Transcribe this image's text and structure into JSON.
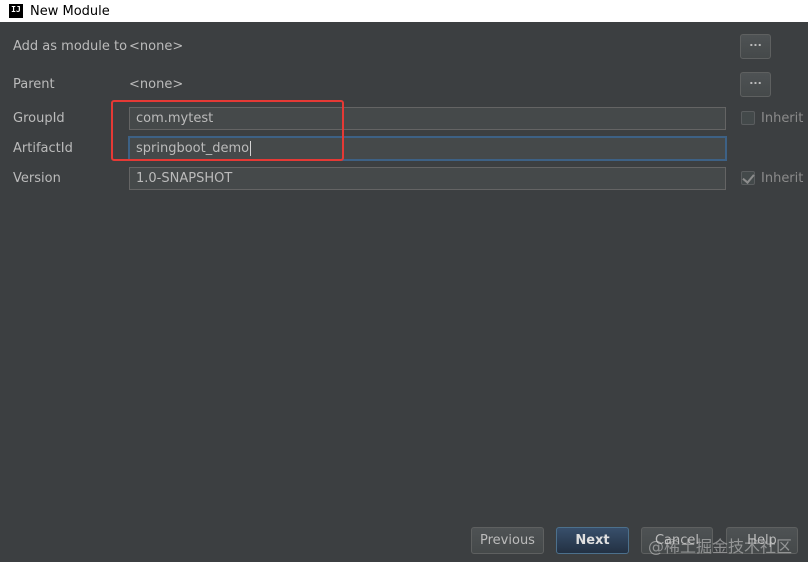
{
  "window": {
    "title": "New Module"
  },
  "form": {
    "add_as_module_to": {
      "label": "Add as module to",
      "value": "<none>",
      "button": "..."
    },
    "parent": {
      "label": "Parent",
      "value": "<none>",
      "button": "..."
    },
    "group_id": {
      "label": "GroupId",
      "value": "com.mytest",
      "inherit_label": "Inherit",
      "inherit_checked": false
    },
    "artifact_id": {
      "label": "ArtifactId",
      "value": "springboot_demo"
    },
    "version": {
      "label": "Version",
      "value": "1.0-SNAPSHOT",
      "inherit_label": "Inherit",
      "inherit_checked": true
    }
  },
  "footer": {
    "previous": "Previous",
    "next": "Next",
    "cancel": "Cancel",
    "help": "Help"
  },
  "watermark": "@稀土掘金技术社区"
}
